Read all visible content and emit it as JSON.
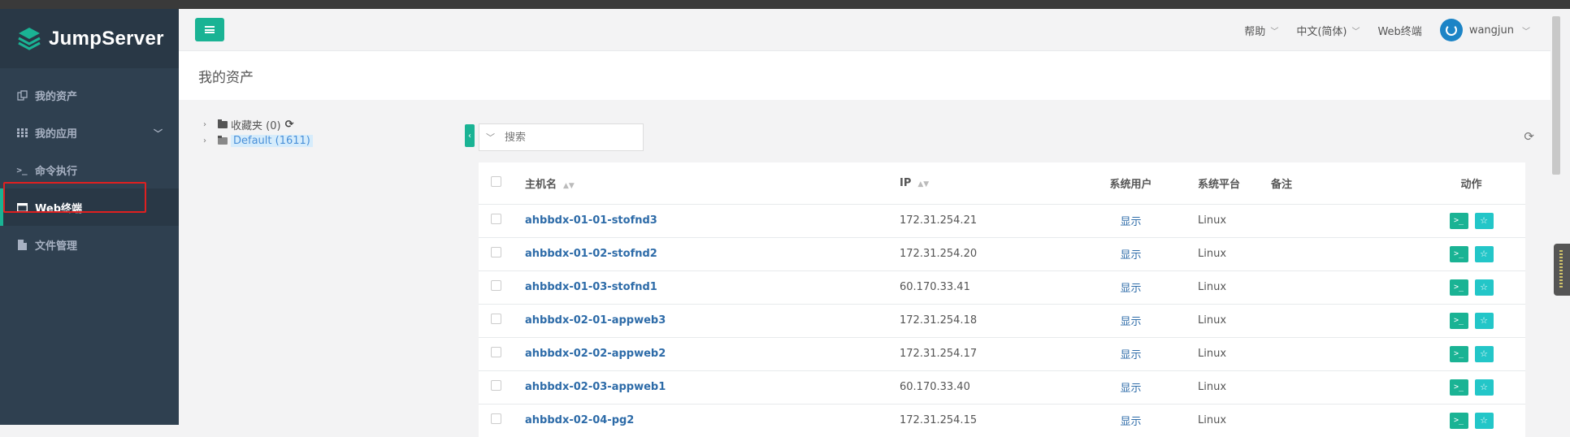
{
  "app": {
    "name": "JumpServer"
  },
  "sidebar": {
    "items": [
      {
        "label": "我的资产",
        "icon": "assets-icon"
      },
      {
        "label": "我的应用",
        "icon": "grid-icon",
        "has_caret": true
      },
      {
        "label": "命令执行",
        "icon": "terminal-prompt-icon"
      },
      {
        "label": "Web终端",
        "icon": "window-icon",
        "active": true
      },
      {
        "label": "文件管理",
        "icon": "file-icon"
      }
    ]
  },
  "topbar": {
    "help": "帮助",
    "language": "中文(简体)",
    "web_terminal": "Web终端",
    "username": "wangjun"
  },
  "page": {
    "title": "我的资产"
  },
  "tree": {
    "favorites": "收藏夹 (0)",
    "default": "Default (1611)"
  },
  "search": {
    "placeholder": "搜索"
  },
  "table": {
    "headers": {
      "hostname": "主机名",
      "ip": "IP",
      "system_user": "系统用户",
      "platform": "系统平台",
      "comment": "备注",
      "actions": "动作"
    },
    "rows": [
      {
        "hostname": "ahbbdx-01-01-stofnd3",
        "ip": "172.31.254.21",
        "system_user": "显示",
        "platform": "Linux"
      },
      {
        "hostname": "ahbbdx-01-02-stofnd2",
        "ip": "172.31.254.20",
        "system_user": "显示",
        "platform": "Linux"
      },
      {
        "hostname": "ahbbdx-01-03-stofnd1",
        "ip": "60.170.33.41",
        "system_user": "显示",
        "platform": "Linux"
      },
      {
        "hostname": "ahbbdx-02-01-appweb3",
        "ip": "172.31.254.18",
        "system_user": "显示",
        "platform": "Linux"
      },
      {
        "hostname": "ahbbdx-02-02-appweb2",
        "ip": "172.31.254.17",
        "system_user": "显示",
        "platform": "Linux"
      },
      {
        "hostname": "ahbbdx-02-03-appweb1",
        "ip": "60.170.33.40",
        "system_user": "显示",
        "platform": "Linux"
      },
      {
        "hostname": "ahbbdx-02-04-pg2",
        "ip": "172.31.254.15",
        "system_user": "显示",
        "platform": "Linux"
      }
    ]
  },
  "colors": {
    "accent": "#1ab394",
    "sidebar": "#2f4050",
    "link": "#2d6ba8",
    "highlight": "#e02020"
  }
}
